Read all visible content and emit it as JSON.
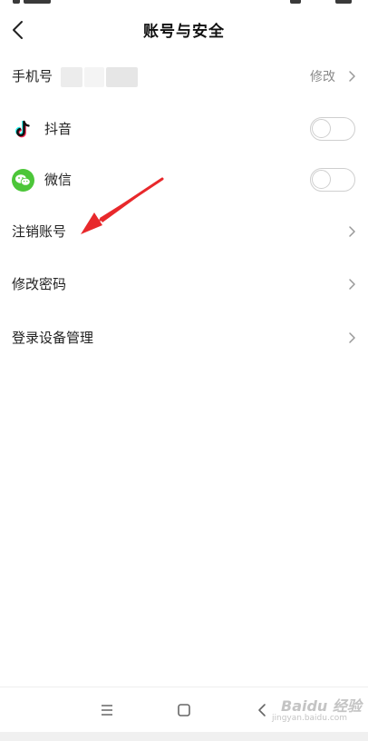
{
  "header": {
    "title": "账号与安全"
  },
  "rows": {
    "phone": {
      "label": "手机号",
      "action": "修改"
    },
    "douyin": {
      "label": "抖音",
      "toggle_on": false
    },
    "wechat": {
      "label": "微信",
      "toggle_on": false
    },
    "deactivate": {
      "label": "注销账号"
    },
    "change_password": {
      "label": "修改密码"
    },
    "device_management": {
      "label": "登录设备管理"
    }
  },
  "icons": {
    "back": "back-arrow-icon",
    "douyin": "douyin-logo-icon",
    "wechat": "wechat-logo-icon",
    "chevron": "chevron-right-icon",
    "nav_menu": "menu-icon",
    "nav_home": "home-square-icon",
    "nav_back": "back-triangle-icon"
  },
  "colors": {
    "wechat_green": "#4CC639",
    "annotation_red": "#E8282B",
    "douyin_cyan": "#25F4EE",
    "douyin_pink": "#FE2C55"
  },
  "watermark": {
    "logo": "Baidu 经验",
    "url": "jingyan.baidu.com"
  }
}
